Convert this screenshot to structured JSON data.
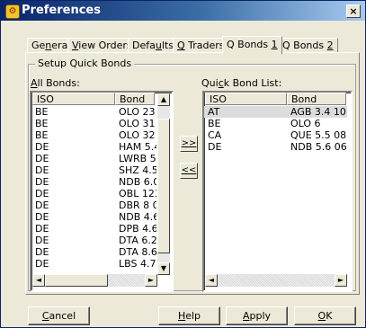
{
  "window": {
    "title": "Preferences",
    "close_glyph": "×",
    "icon": "preferences-app-icon"
  },
  "tabs": [
    {
      "pre": "Ge",
      "key": "n",
      "post": "eral",
      "active": false
    },
    {
      "pre": "",
      "key": "V",
      "post": "iew Orders",
      "active": false
    },
    {
      "pre": "Defa",
      "key": "u",
      "post": "lts",
      "active": false
    },
    {
      "pre": "",
      "key": "Q",
      "post": " Traders",
      "active": false
    },
    {
      "pre": "Q Bonds ",
      "key": "1",
      "post": "",
      "active": true
    },
    {
      "pre": "Q Bonds ",
      "key": "2",
      "post": "",
      "active": false
    }
  ],
  "group": {
    "label": "Setup Quick Bonds"
  },
  "all_bonds": {
    "label_key": "A",
    "label_post": "ll Bonds:",
    "columns": [
      "ISO",
      "Bond"
    ],
    "rows": [
      {
        "iso": "BE",
        "bond": "OLO 23"
      },
      {
        "iso": "BE",
        "bond": "OLO 31"
      },
      {
        "iso": "BE",
        "bond": "OLO 32"
      },
      {
        "iso": "DE",
        "bond": "HAM 5.4"
      },
      {
        "iso": "DE",
        "bond": "LWRB 5."
      },
      {
        "iso": "DE",
        "bond": "SHZ 4.5"
      },
      {
        "iso": "DE",
        "bond": "NDB 6.0"
      },
      {
        "iso": "DE",
        "bond": "OBL 123"
      },
      {
        "iso": "DE",
        "bond": "DBR 8 07"
      },
      {
        "iso": "DE",
        "bond": "NDB 4.6"
      },
      {
        "iso": "DE",
        "bond": "DPB 4.67"
      },
      {
        "iso": "DE",
        "bond": "DTA 6.2"
      },
      {
        "iso": "DE",
        "bond": "DTA 8.6"
      },
      {
        "iso": "DE",
        "bond": "LBS 4.75"
      }
    ]
  },
  "quick_list": {
    "label_pre": "Qui",
    "label_key": "c",
    "label_post": "k Bond List:",
    "columns": [
      "ISO",
      "Bond"
    ],
    "rows": [
      {
        "iso": "AT",
        "bond": "AGB 3.4 10/",
        "selected": true
      },
      {
        "iso": "BE",
        "bond": "OLO 6",
        "selected": false
      },
      {
        "iso": "CA",
        "bond": "QUE 5.5 08/",
        "selected": false
      },
      {
        "iso": "DE",
        "bond": "NDB 5.6 06/",
        "selected": false
      }
    ]
  },
  "move": {
    "add_label": ">>",
    "remove_label": "<<"
  },
  "scroll": {
    "up": "▲",
    "down": "▼",
    "left": "◄",
    "right": "►"
  },
  "buttons": {
    "cancel": {
      "key": "C",
      "post": "ancel"
    },
    "help": {
      "key": "H",
      "post": "elp"
    },
    "apply": {
      "key": "A",
      "post": "pply"
    },
    "ok": {
      "key": "O",
      "post": "K"
    }
  }
}
